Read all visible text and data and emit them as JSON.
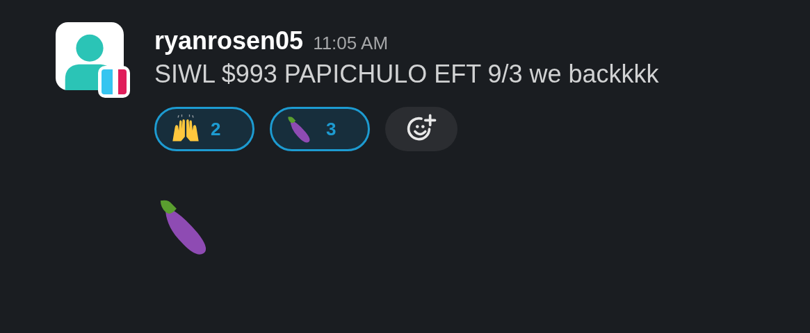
{
  "message": {
    "author": "ryanrosen05",
    "time": "11:05 AM",
    "text": "SIWL $993 PAPICHULO EFT 9/3 we backkkk",
    "reactions": [
      {
        "kind": "raised-hands",
        "count": "2",
        "selected": true
      },
      {
        "kind": "eggplant",
        "count": "3",
        "selected": true
      }
    ]
  },
  "follow_up": {
    "kind": "eggplant"
  }
}
